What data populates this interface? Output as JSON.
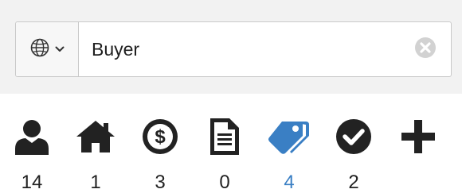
{
  "colors": {
    "icon_default": "#222222",
    "icon_active": "#3a7fc4",
    "clear_icon": "#d2d2d2",
    "panel_background": "#f2f2f2"
  },
  "search": {
    "scope_icon": "globe-icon",
    "scope_caret_icon": "chevron-down-icon",
    "value": "Buyer",
    "clear_icon": "clear-circle-icon"
  },
  "stats": [
    {
      "icon": "user-icon",
      "count": "14",
      "active": false
    },
    {
      "icon": "home-icon",
      "count": "1",
      "active": false
    },
    {
      "icon": "dollar-circle-icon",
      "count": "3",
      "active": false
    },
    {
      "icon": "document-icon",
      "count": "0",
      "active": false
    },
    {
      "icon": "tags-icon",
      "count": "4",
      "active": true
    },
    {
      "icon": "check-circle-icon",
      "count": "2",
      "active": false
    },
    {
      "icon": "plus-icon",
      "count": "",
      "active": false
    }
  ]
}
